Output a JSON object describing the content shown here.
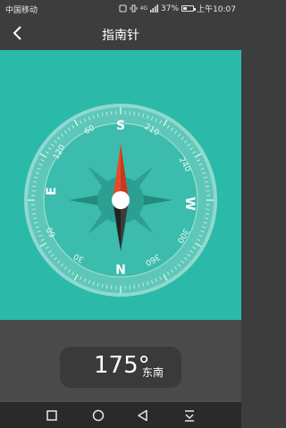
{
  "status_bar": {
    "carrier": "中国移动",
    "network": "4G",
    "battery_level": 0.37,
    "battery_text": "37%",
    "time": "上午10:07"
  },
  "header": {
    "title": "指南针"
  },
  "compass": {
    "cardinals": {
      "north": "N",
      "south": "S",
      "east": "E",
      "west": "W"
    },
    "degree_labels": [
      "30",
      "60",
      "120",
      "150",
      "210",
      "240",
      "300",
      "360"
    ],
    "colors": {
      "background": "#2bbaa9",
      "needle_south": "#e84a2a",
      "needle_north": "#222222"
    }
  },
  "reading": {
    "degrees": "175°",
    "direction": "东南"
  }
}
